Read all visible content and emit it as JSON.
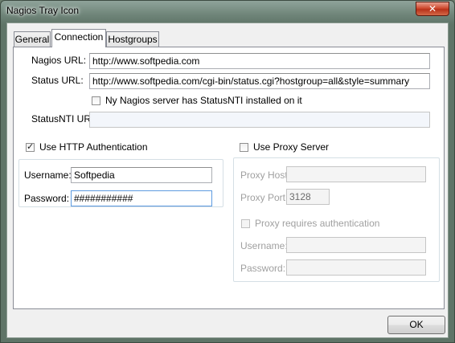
{
  "window": {
    "title": "Nagios Tray Icon",
    "close_glyph": "✕"
  },
  "tabs": [
    {
      "label": "General"
    },
    {
      "label": "Connection"
    },
    {
      "label": "Hostgroups"
    }
  ],
  "nagios_url": {
    "label": "Nagios URL:",
    "value": "http://www.softpedia.com"
  },
  "status_url": {
    "label": "Status URL:",
    "value": "http://www.softpedia.com/cgi-bin/status.cgi?hostgroup=all&style=summary"
  },
  "statusnti_checkbox": {
    "label": "Ny Nagios server has StatusNTI installed on it",
    "checked": false
  },
  "statusnti_url": {
    "label": "StatusNTI URL:",
    "value": ""
  },
  "http_auth": {
    "checkbox_label": "Use HTTP Authentication",
    "checked": true,
    "username_label": "Username:",
    "username_value": "Softpedia",
    "password_label": "Password:",
    "password_value": "###########"
  },
  "proxy": {
    "checkbox_label": "Use Proxy Server",
    "checked": false,
    "host_label": "Proxy Host:",
    "host_value": "",
    "port_label": "Proxy Port:",
    "port_value": "3128",
    "auth_label": "Proxy requires authentication",
    "username_label": "Username:",
    "username_value": "",
    "password_label": "Password:",
    "password_value": ""
  },
  "buttons": {
    "ok": "OK"
  },
  "colors": {
    "close_button": "#c8432b",
    "dialog_bg": "#f0f0f0",
    "panel_bg": "#ffffff"
  }
}
